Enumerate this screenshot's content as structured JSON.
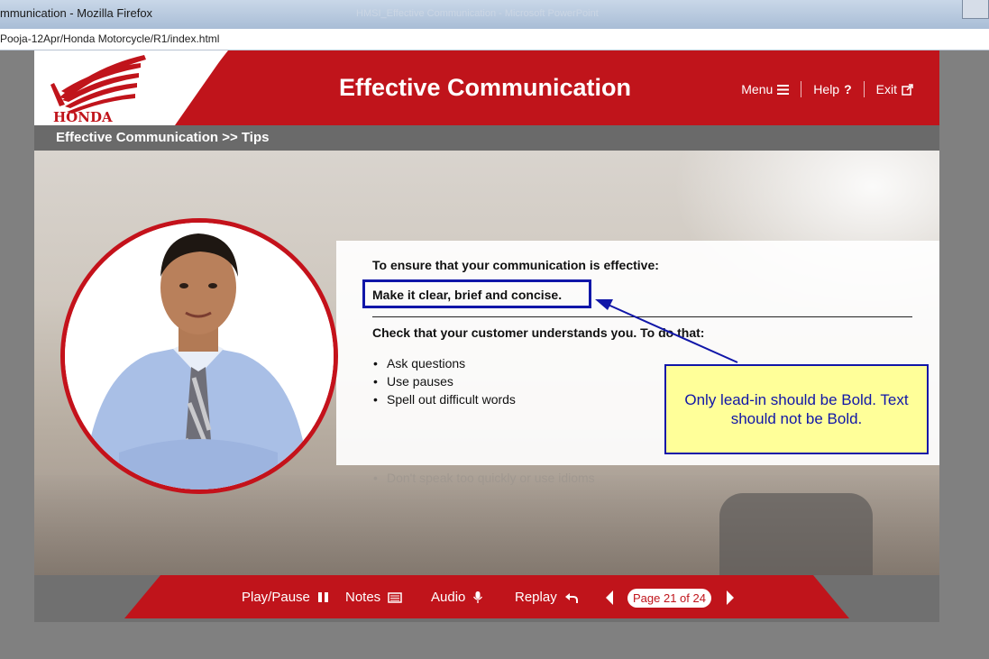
{
  "browser": {
    "window_title": "mmunication - Mozilla Firefox",
    "faded_title": "HMSI_Effective Communication - Microsoft PowerPoint",
    "url": "Pooja-12Apr/Honda Motorcycle/R1/index.html"
  },
  "header": {
    "logo_text": "HONDA",
    "course_title": "Effective Communication",
    "nav": {
      "menu": "Menu",
      "help": "Help",
      "exit": "Exit"
    }
  },
  "breadcrumb": "Effective Communication >> Tips",
  "content": {
    "lead_in_1": "To ensure that your communication is effective:",
    "highlighted_text": "Make it clear, brief and concise.",
    "lead_in_2": "Check that your customer understands you. To do that:",
    "bullets": [
      "Ask questions",
      "Use pauses",
      "Spell out difficult words"
    ],
    "faded_bullet": "Don't speak too quickly or use idioms"
  },
  "callout": {
    "text": "Only lead-in should be Bold. Text should not be Bold."
  },
  "footer": {
    "play_pause": "Play/Pause",
    "notes": "Notes",
    "audio": "Audio",
    "replay": "Replay",
    "page_indicator": "Page 21 of 24"
  },
  "colors": {
    "brand_red": "#c0141b",
    "annotation_blue": "#1016a8",
    "callout_yellow": "#ffff99"
  }
}
